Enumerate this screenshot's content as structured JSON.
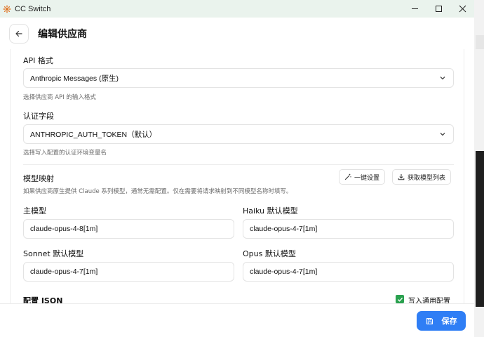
{
  "window": {
    "title": "CC Switch"
  },
  "header": {
    "title": "编辑供应商"
  },
  "form": {
    "api_format": {
      "label": "API 格式",
      "value": "Anthropic Messages (原生)",
      "hint": "选择供应商 API 的输入格式"
    },
    "auth_field": {
      "label": "认证字段",
      "value": "ANTHROPIC_AUTH_TOKEN（默认）",
      "hint": "选择写入配置的认证环境变量名"
    },
    "model_mapping": {
      "title": "模型映射",
      "hint": "如果供应商原生提供 Claude 系列模型，通常无需配置。仅在需要将请求映射到不同模型名称时填写。",
      "one_click_label": "一键设置",
      "fetch_models_label": "获取模型列表",
      "main_model": {
        "label": "主模型",
        "value": "claude-opus-4-8[1m]"
      },
      "haiku_model": {
        "label": "Haiku 默认模型",
        "value": "claude-opus-4-7[1m]"
      },
      "sonnet_model": {
        "label": "Sonnet 默认模型",
        "value": "claude-opus-4-7[1m]"
      },
      "opus_model": {
        "label": "Opus 默认模型",
        "value": "claude-opus-4-7[1m]"
      }
    },
    "config_json": {
      "label": "配置 JSON",
      "write_common_label": "写入通用配置",
      "write_common_checked": true
    }
  },
  "footer": {
    "save_label": "保存"
  },
  "colors": {
    "accent": "#2f7ef5",
    "check": "#2aa14f",
    "titlebar": "#eaf3ed"
  }
}
